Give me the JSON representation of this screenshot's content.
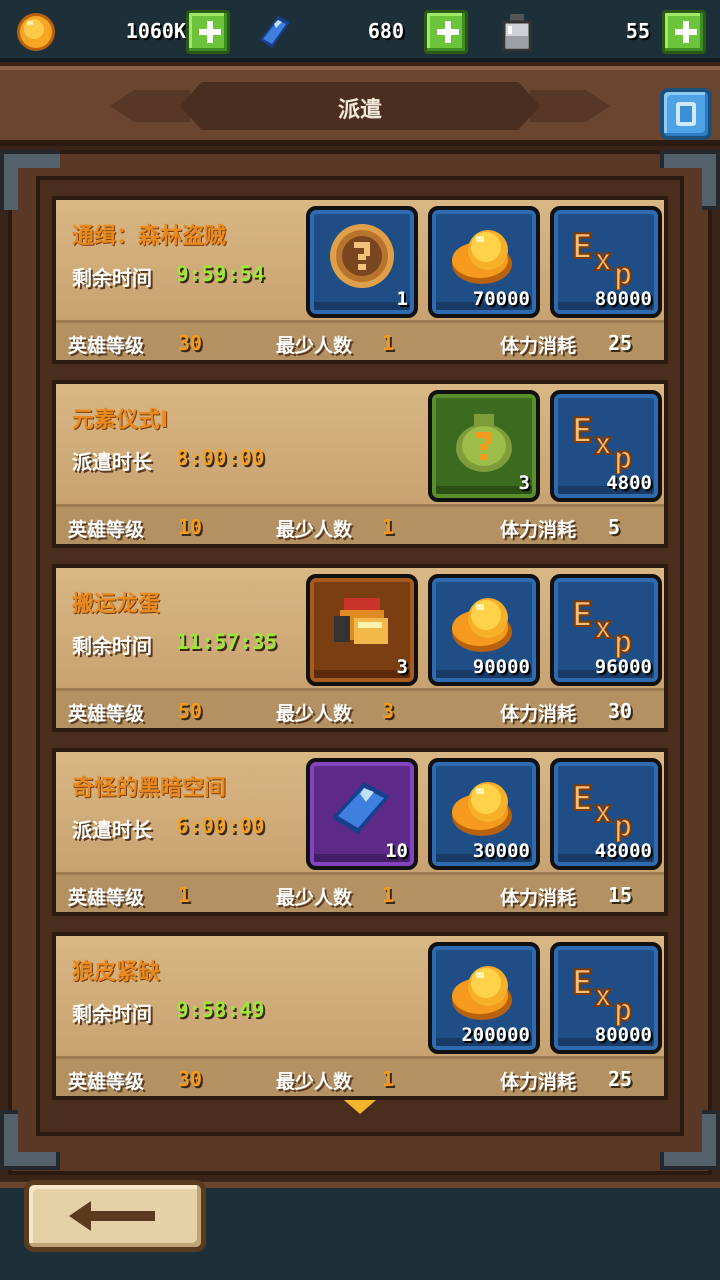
{
  "resources": [
    {
      "name": "gold",
      "icon": "gold-coin-icon",
      "value": "1060K"
    },
    {
      "name": "gems",
      "icon": "blue-gem-icon",
      "value": "680"
    },
    {
      "name": "stamina",
      "icon": "potion-bottle-icon",
      "value": "55"
    }
  ],
  "header": {
    "title": "派遣"
  },
  "quests": [
    {
      "name": "通缉：森林盗贼",
      "time_label": "剩余时间",
      "time_value": "9:59:54",
      "time_kind": "countdown",
      "hero_level_label": "英雄等级",
      "hero_level": "30",
      "min_people_label": "最少人数",
      "min_people": "1",
      "stamina_label": "体力消耗",
      "stamina_cost": "25",
      "rewards": [
        {
          "type": "mystery-coin",
          "frame": "blue",
          "qty": "1"
        },
        {
          "type": "gold",
          "frame": "blue",
          "qty": "70000"
        },
        {
          "type": "exp",
          "frame": "blue",
          "qty": "80000"
        }
      ]
    },
    {
      "name": "元素仪式Ⅰ",
      "time_label": "派遣时长",
      "time_value": "8:00:00",
      "time_kind": "duration",
      "hero_level_label": "英雄等级",
      "hero_level": "10",
      "min_people_label": "最少人数",
      "min_people": "1",
      "stamina_label": "体力消耗",
      "stamina_cost": "5",
      "rewards": [
        {
          "type": "mystery-bag",
          "frame": "green",
          "qty": "3"
        },
        {
          "type": "exp",
          "frame": "blue",
          "qty": "4800"
        }
      ]
    },
    {
      "name": "搬运龙蛋",
      "time_label": "剩余时间",
      "time_value": "11:57:35",
      "time_kind": "countdown",
      "hero_level_label": "英雄等级",
      "hero_level": "50",
      "min_people_label": "最少人数",
      "min_people": "3",
      "stamina_label": "体力消耗",
      "stamina_cost": "30",
      "rewards": [
        {
          "type": "equipment",
          "frame": "brown",
          "qty": "3"
        },
        {
          "type": "gold",
          "frame": "blue",
          "qty": "90000"
        },
        {
          "type": "exp",
          "frame": "blue",
          "qty": "96000"
        }
      ]
    },
    {
      "name": "奇怪的黑暗空间",
      "time_label": "派遣时长",
      "time_value": "6:00:00",
      "time_kind": "duration",
      "hero_level_label": "英雄等级",
      "hero_level": "1",
      "min_people_label": "最少人数",
      "min_people": "1",
      "stamina_label": "体力消耗",
      "stamina_cost": "15",
      "rewards": [
        {
          "type": "gem",
          "frame": "purple",
          "qty": "10"
        },
        {
          "type": "gold",
          "frame": "blue",
          "qty": "30000"
        },
        {
          "type": "exp",
          "frame": "blue",
          "qty": "48000"
        }
      ]
    },
    {
      "name": "狼皮紧缺",
      "time_label": "剩余时间",
      "time_value": "9:58:49",
      "time_kind": "countdown",
      "hero_level_label": "英雄等级",
      "hero_level": "30",
      "min_people_label": "最少人数",
      "min_people": "1",
      "stamina_label": "体力消耗",
      "stamina_cost": "25",
      "rewards": [
        {
          "type": "gold",
          "frame": "blue",
          "qty": "200000"
        },
        {
          "type": "exp",
          "frame": "blue",
          "qty": "80000"
        }
      ]
    }
  ],
  "colors": {
    "quest_name": "#e98a1e",
    "countdown": "#9ee63c",
    "duration": "#f2a12a",
    "footer_value": "#f39a1c"
  }
}
